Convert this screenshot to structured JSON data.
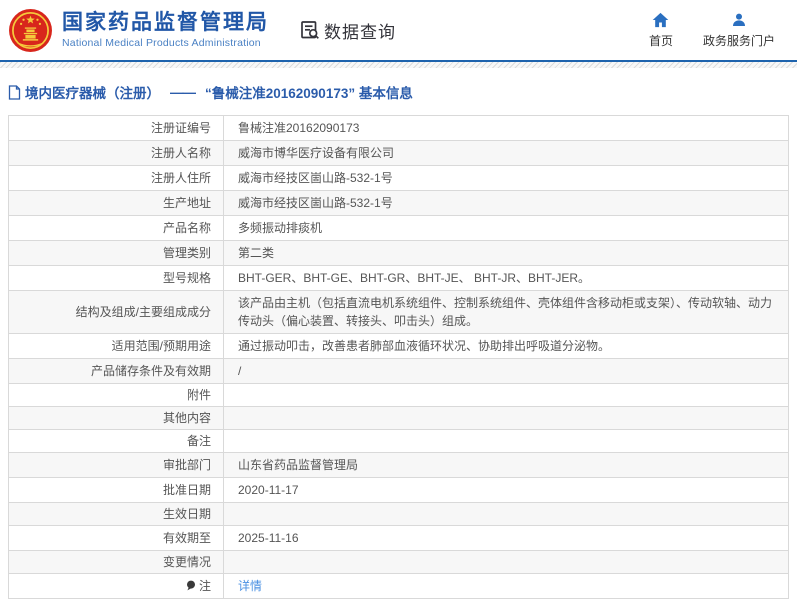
{
  "header": {
    "brand_cn": "国家药品监督管理局",
    "brand_en": "National Medical Products Administration",
    "data_query_label": "数据查询",
    "home_label": "首页",
    "portal_label": "政务服务门户"
  },
  "breadcrumb": {
    "category": "境内医疗器械（注册）",
    "separator": "——",
    "title": "“鲁械注准20162090173” 基本信息"
  },
  "table": {
    "rows": [
      {
        "label": "注册证编号",
        "value": "鲁械注准20162090173"
      },
      {
        "label": "注册人名称",
        "value": "威海市博华医疗设备有限公司"
      },
      {
        "label": "注册人住所",
        "value": "威海市经技区崮山路-532-1号"
      },
      {
        "label": "生产地址",
        "value": "威海市经技区崮山路-532-1号"
      },
      {
        "label": "产品名称",
        "value": "多频振动排痰机"
      },
      {
        "label": "管理类别",
        "value": "第二类"
      },
      {
        "label": "型号规格",
        "value": "BHT-GER、BHT-GE、BHT-GR、BHT-JE、 BHT-JR、BHT-JER。"
      },
      {
        "label": "结构及组成/主要组成成分",
        "value": "该产品由主机（包括直流电机系统组件、控制系统组件、壳体组件含移动柜或支架）、传动软轴、动力传动头（偏心装置、转接头、叩击头）组成。"
      },
      {
        "label": "适用范围/预期用途",
        "value": "通过振动叩击，改善患者肺部血液循环状况、协助排出呼吸道分泌物。"
      },
      {
        "label": "产品储存条件及有效期",
        "value": "/"
      },
      {
        "label": "附件",
        "value": ""
      },
      {
        "label": "其他内容",
        "value": ""
      },
      {
        "label": "备注",
        "value": ""
      },
      {
        "label": "审批部门",
        "value": "山东省药品监督管理局"
      },
      {
        "label": "批准日期",
        "value": "2020-11-17"
      },
      {
        "label": "生效日期",
        "value": ""
      },
      {
        "label": "有效期至",
        "value": "2025-11-16"
      },
      {
        "label": "变更情况",
        "value": ""
      },
      {
        "label": "注",
        "value": "详情",
        "link": true,
        "label_icon": "note-icon"
      }
    ]
  },
  "colors": {
    "accent_blue": "#1e63ad",
    "brand_blue": "#2157a7",
    "icon_blue": "#2a6fc0",
    "link_blue": "#4a90e2",
    "emblem_red": "#d8261c",
    "emblem_gold": "#f5c93c",
    "row_alt_bg": "#f7f7f7",
    "border_gray": "#d9d9d9"
  }
}
